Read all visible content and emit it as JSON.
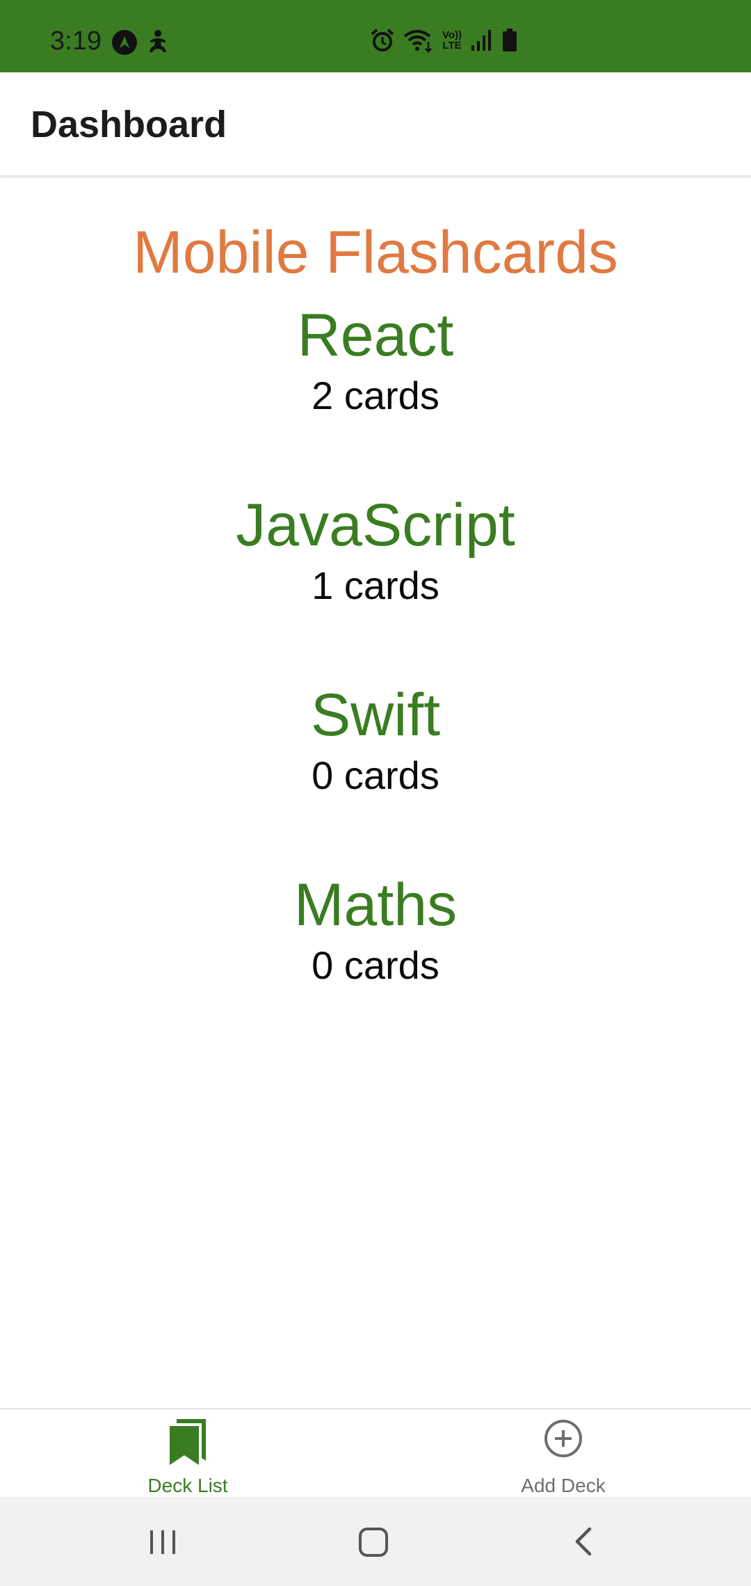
{
  "status_bar": {
    "time": "3:19",
    "background": "#3a7c22",
    "icons": [
      "navigation-icon",
      "accessibility-icon",
      "alarm-icon",
      "wifi-icon",
      "volte-icon",
      "signal-icon",
      "battery-icon"
    ],
    "volte_label_top": "Vo))",
    "volte_label_bottom": "LTE"
  },
  "header": {
    "title": "Dashboard"
  },
  "main": {
    "app_title": "Mobile Flashcards",
    "app_title_color": "#e07a40",
    "deck_title_color": "#3a7c22",
    "decks": [
      {
        "title": "React",
        "count": "2 cards"
      },
      {
        "title": "JavaScript",
        "count": "1 cards"
      },
      {
        "title": "Swift",
        "count": "0 cards"
      },
      {
        "title": "Maths",
        "count": "0 cards"
      }
    ]
  },
  "tabs": [
    {
      "label": "Deck List",
      "icon": "bookmarks-icon",
      "active": true
    },
    {
      "label": "Add Deck",
      "icon": "add-circle-icon",
      "active": false
    }
  ],
  "nav_bar": {
    "icons": [
      "recent-apps-icon",
      "home-icon",
      "back-icon"
    ]
  }
}
